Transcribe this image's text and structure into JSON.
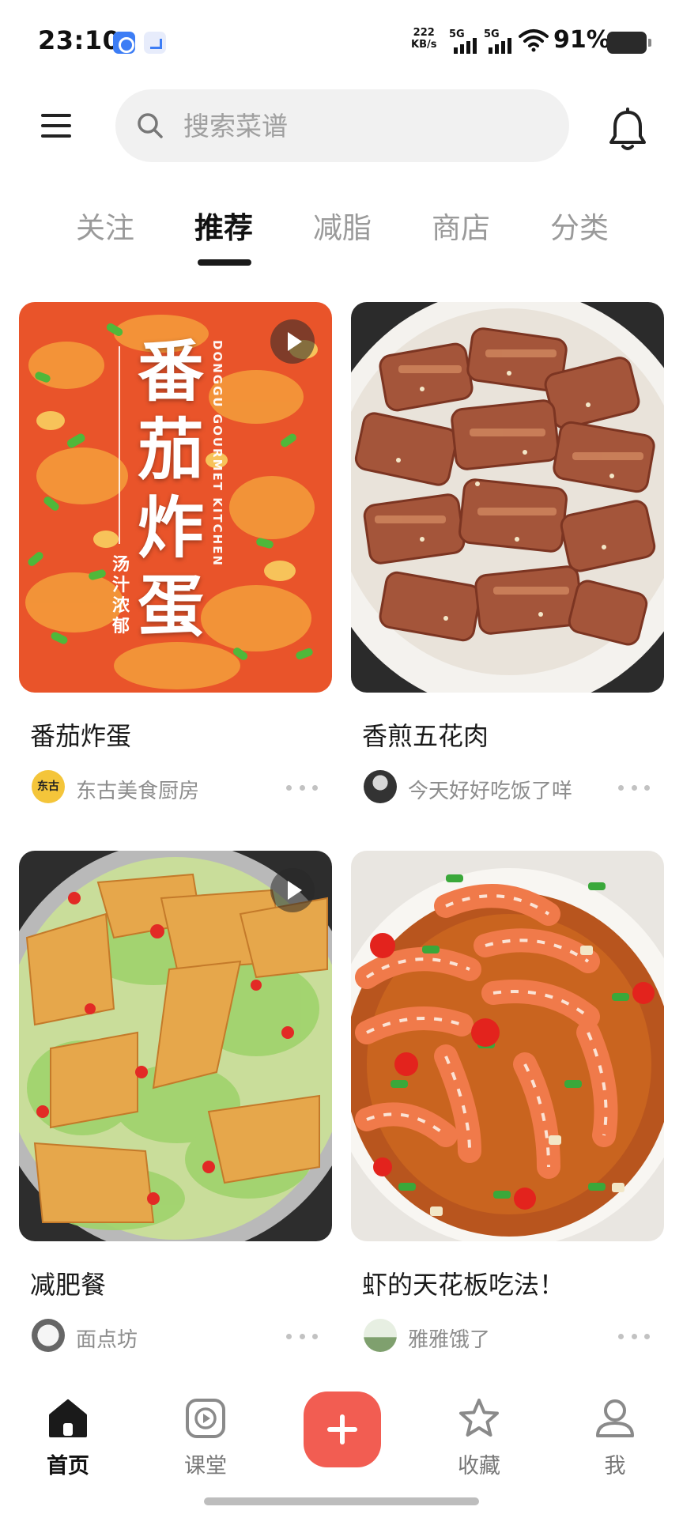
{
  "status_bar": {
    "time": "23:10",
    "net_speed_value": "222",
    "net_speed_unit": "KB/s",
    "sim1_label": "5G",
    "sim2_label": "5G",
    "battery": "91%"
  },
  "header": {
    "search_placeholder": "搜索菜谱",
    "icons": [
      "menu-icon",
      "search-icon",
      "bell-icon"
    ]
  },
  "tabs": [
    {
      "label": "关注",
      "active": false
    },
    {
      "label": "推荐",
      "active": true
    },
    {
      "label": "减脂",
      "active": false
    },
    {
      "label": "商店",
      "active": false
    },
    {
      "label": "分类",
      "active": false
    }
  ],
  "cards": [
    {
      "title": "番茄炸蛋",
      "author": "东古美食厨房",
      "is_video": true,
      "image": {
        "kind": "tomato-egg",
        "overlay_title": "番茄炸蛋",
        "overlay_sub": "汤汁浓郁",
        "overlay_en": "DONGGU GOURMET KITCHEN"
      },
      "avatar_text": "东古"
    },
    {
      "title": "香煎五花肉",
      "author": "今天好好吃饭了咩",
      "is_video": false,
      "image": {
        "kind": "pork-belly"
      }
    },
    {
      "title": "减肥餐",
      "author": "面点坊",
      "is_video": true,
      "image": {
        "kind": "egg-cabbage"
      }
    },
    {
      "title": "虾的天花板吃法！",
      "author": "雅雅饿了",
      "is_video": false,
      "image": {
        "kind": "shrimp"
      }
    }
  ],
  "bottom_nav": [
    {
      "label": "首页",
      "icon": "home-icon",
      "active": true
    },
    {
      "label": "课堂",
      "icon": "play-square-icon",
      "active": false
    },
    {
      "label": "",
      "icon": "plus-icon",
      "active": false
    },
    {
      "label": "收藏",
      "icon": "star-icon",
      "active": false
    },
    {
      "label": "我",
      "icon": "user-icon",
      "active": false
    }
  ],
  "colors": {
    "accent": "#f25d52",
    "tab_active": "#111111",
    "tab_inactive": "#9a9a9a",
    "search_bg": "#f1f1f1"
  }
}
